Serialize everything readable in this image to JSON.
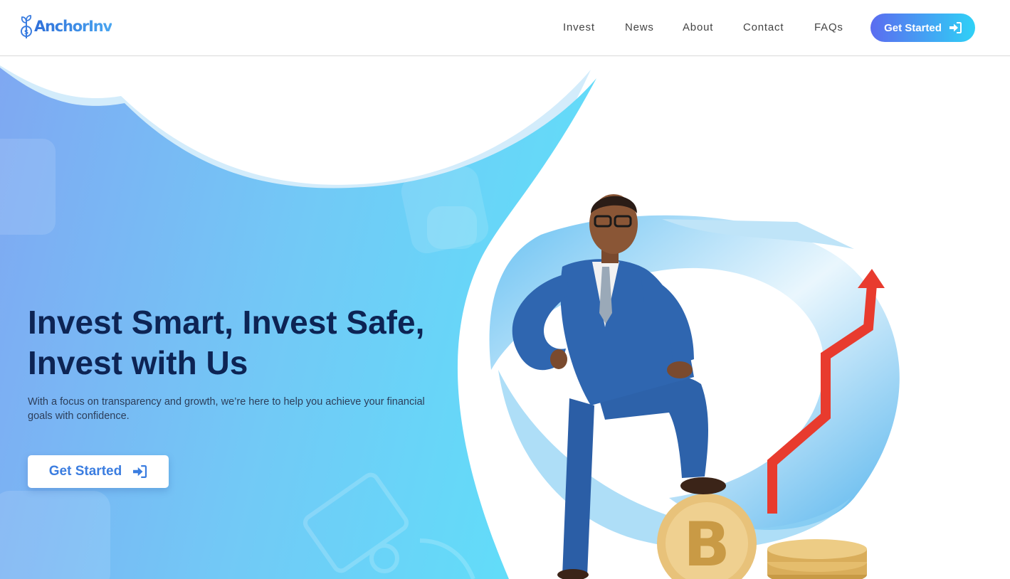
{
  "brand": {
    "name": "AnchorInv",
    "logo_icon": "anchor-plant-coin-icon",
    "colors": {
      "primary": "#3b7de0",
      "navy": "#0d2454",
      "gradient_start": "#5b6cf0",
      "gradient_end": "#2fd1f6"
    }
  },
  "nav": {
    "items": [
      {
        "label": "Invest"
      },
      {
        "label": "News"
      },
      {
        "label": "About"
      },
      {
        "label": "Contact"
      },
      {
        "label": "FAQs"
      }
    ],
    "cta_label": "Get Started",
    "cta_icon": "sign-in-icon"
  },
  "hero": {
    "headline_line1": "Invest Smart, Invest Safe,",
    "headline_line2": "Invest with Us",
    "subtext": "With a focus on transparency and growth, we’re here to help you achieve your financial goals with confidence.",
    "cta_label": "Get Started",
    "cta_icon": "sign-in-icon",
    "illustration": "businessman-on-bitcoin-with-rising-arrow"
  }
}
